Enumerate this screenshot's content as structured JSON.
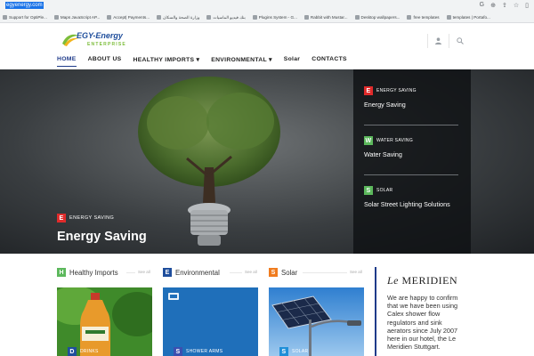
{
  "browser": {
    "url": "egyenergy.com",
    "bookmarks": [
      "Support for OptiPle...",
      "Maps JavaScript AP...",
      "Accept| Payments...",
      "وزارة الصحة والسكان",
      "بنك فيديو الماسيات",
      "Plugins System - G...",
      "Rabbit with Mustar...",
      "Desktop wallpapers...",
      "free templates",
      "templates | Portafo..."
    ]
  },
  "site": {
    "logo_line1": "EGY-Energy",
    "logo_line2": "ENTERPRISE",
    "nav": [
      "HOME",
      "ABOUT US",
      "HEALTHY IMPORTS",
      "ENVIRONMENTAL",
      "Solar",
      "CONTACTS"
    ]
  },
  "hero": {
    "badge": "E",
    "tag": "ENERGY SAVING",
    "title": "Energy Saving"
  },
  "side_list": [
    {
      "badge": "E",
      "tag": "ENERGY SAVING",
      "title": "Energy Saving"
    },
    {
      "badge": "W",
      "tag": "WATER SAVING",
      "title": "Water Saving"
    },
    {
      "badge": "S",
      "tag": "SOLAR",
      "title": "Solar Street Lighting Solutions"
    }
  ],
  "categories": [
    {
      "badge": "H",
      "label": "Healthy Imports",
      "see_all": "See all"
    },
    {
      "badge": "E",
      "label": "Environmental",
      "see_all": "See all"
    },
    {
      "badge": "S",
      "label": "Solar",
      "see_all": "See all"
    }
  ],
  "cards": [
    {
      "badge": "D",
      "tag": "DRINKS"
    },
    {
      "badge": "S",
      "tag": "SHOWER ARMS"
    },
    {
      "badge": "S",
      "tag": "SOLAR"
    }
  ],
  "testimonial": {
    "brand_le": "Le",
    "brand_name": "MERIDIEN",
    "quote": "We are happy to confirm that we have been using Calex shower flow regulators and sink aerators since July 2007 here in our hotel, the Le Meridien Stuttgart."
  },
  "colors": {
    "nav_active": "#1f3b8a",
    "badge_red": "#e02b2b",
    "badge_green": "#5cb85c",
    "badge_blue": "#1f4e9c",
    "badge_orange": "#f07c1f"
  }
}
